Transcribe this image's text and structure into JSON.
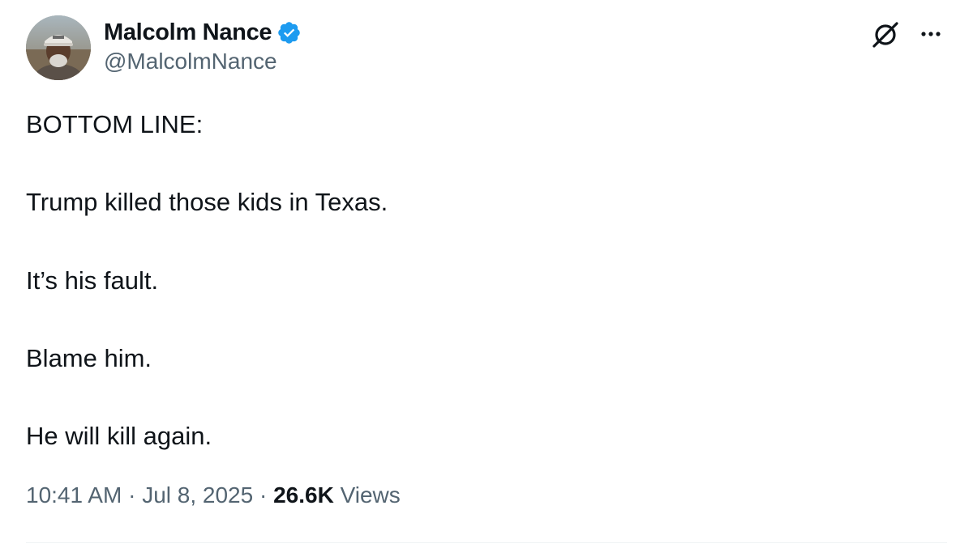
{
  "author": {
    "name": "Malcolm Nance",
    "handle": "@MalcolmNance",
    "verified": true,
    "verified_color": "#1d9bf0"
  },
  "tweet": {
    "lines": [
      "BOTTOM LINE:",
      "Trump killed those kids in Texas.",
      "It’s his fault.",
      "Blame him.",
      "He will kill again."
    ],
    "time": "10:41 AM",
    "separator": "·",
    "date": "Jul 8, 2025",
    "views_count": "26.6K",
    "views_label": "Views"
  },
  "icons": {
    "grok": "grok-icon",
    "more": "more-options-icon",
    "verified": "verified-badge-icon"
  },
  "colors": {
    "text_primary": "#0f1419",
    "text_secondary": "#536471",
    "divider": "#eff3f4"
  }
}
